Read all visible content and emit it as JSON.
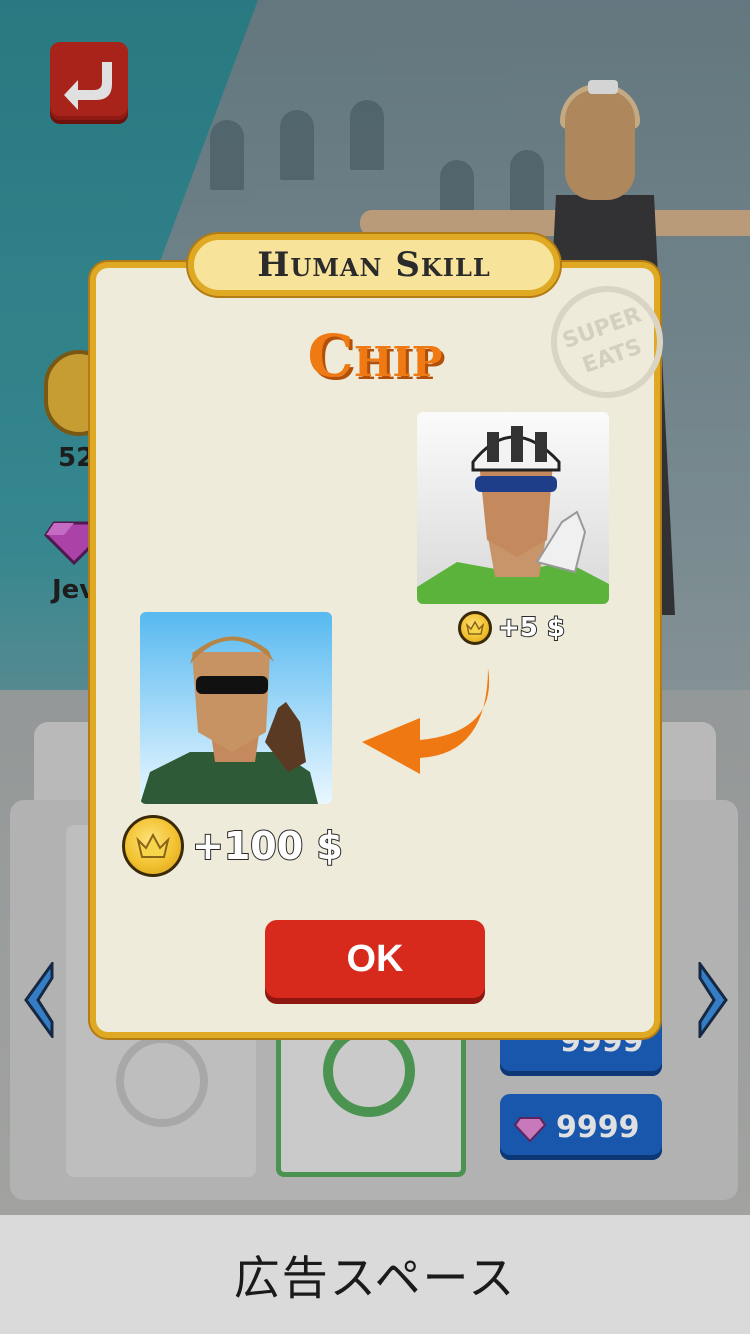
{
  "dialog": {
    "header": "Human Skill",
    "character_name": "Chip",
    "from_bonus": "+5 $",
    "to_bonus": "+100 $",
    "ok_label": "OK",
    "stamp_text": "SUPER EATS"
  },
  "background": {
    "coin_count": "52",
    "jewel_label": "Jev",
    "price_coin": "9999",
    "price_gem": "9999"
  },
  "ad_bar": {
    "text": "広告スペース"
  },
  "colors": {
    "accent_orange": "#ef7a14",
    "dialog_border": "#e0a924",
    "ok_red": "#d72a1c",
    "price_blue": "#1d63c4"
  }
}
